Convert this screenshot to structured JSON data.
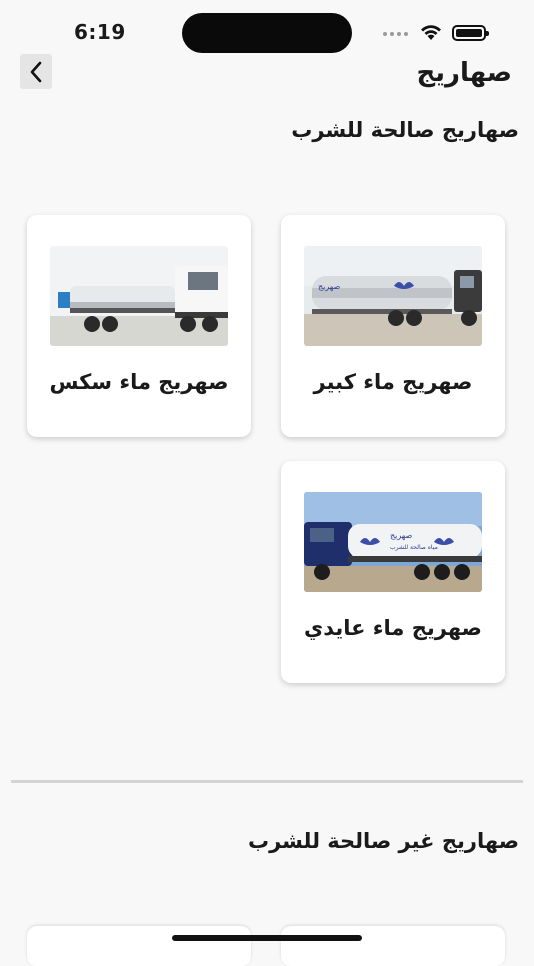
{
  "status_bar": {
    "time": "6:19"
  },
  "header": {
    "title": "صهاريج"
  },
  "sections": [
    {
      "title": "صهاريج صالحة للشرب",
      "items": [
        {
          "label": "صهريج ماء كبير"
        },
        {
          "label": "صهريج ماء سكس"
        },
        {
          "label": "صهريج ماء عايدي"
        }
      ]
    },
    {
      "title": "صهاريج غير صالحة للشرب"
    }
  ],
  "tanker_text": {
    "brand": "صهريج",
    "tagline": "مياه صالحة للشرب"
  },
  "colors": {
    "background": "#f8f8f8",
    "card": "#ffffff",
    "divider": "#d4d4d4"
  }
}
